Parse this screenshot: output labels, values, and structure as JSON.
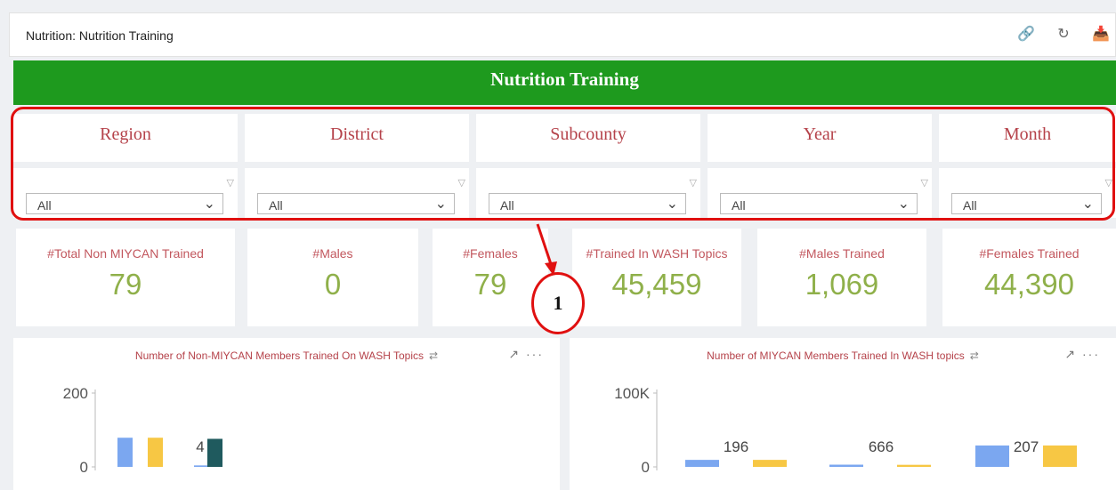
{
  "header": {
    "title": "Nutrition: Nutrition Training",
    "icons": [
      "link-icon",
      "refresh-icon",
      "inbox-download-icon"
    ]
  },
  "banner": {
    "title": "Nutrition Training"
  },
  "filters": [
    {
      "label": "Region",
      "value": "All"
    },
    {
      "label": "District",
      "value": "All"
    },
    {
      "label": "Subcounty",
      "value": "All"
    },
    {
      "label": "Year",
      "value": "All"
    },
    {
      "label": "Month",
      "value": "All"
    }
  ],
  "kpis": [
    {
      "label": "#Total Non MIYCAN Trained",
      "value": "79"
    },
    {
      "label": "#Males",
      "value": "0"
    },
    {
      "label": "#Females",
      "value": "79"
    },
    {
      "label": "#Trained In WASH Topics",
      "value": "45,459"
    },
    {
      "label": "#Males Trained",
      "value": "1,069"
    },
    {
      "label": "#Females Trained",
      "value": "44,390"
    }
  ],
  "annotation": {
    "callout_number": "1",
    "outline_color": "#e01010"
  },
  "colors": {
    "banner": "#1e9a1e",
    "label_red": "#b5424a",
    "kpi_green": "#8fb04a",
    "bar_blue": "#7ba7f0",
    "bar_yellow": "#f7c744",
    "bar_teal": "#1f5a5e"
  },
  "chart_data": [
    {
      "type": "bar",
      "title": "Number of Non-MIYCAN Members Trained On WASH Topics",
      "ylim": [
        0,
        200
      ],
      "yticks": [
        "0",
        "200"
      ],
      "series": [
        {
          "values": [
            79,
            0,
            0
          ]
        },
        {
          "values": [
            79,
            0,
            0
          ]
        },
        {
          "values": [
            0,
            4,
            0
          ]
        },
        {
          "values": [
            0,
            76,
            0
          ]
        }
      ],
      "data_labels": [
        {
          "text": "4"
        }
      ]
    },
    {
      "type": "bar",
      "title": "Number of MIYCAN Members Trained In WASH topics",
      "ylim": [
        0,
        100000
      ],
      "yticks": [
        "0",
        "100K"
      ],
      "series": [
        {
          "values": [
            9500,
            3000,
            29000
          ]
        },
        {
          "values": [
            9500,
            2800,
            29000
          ]
        }
      ],
      "data_labels": [
        {
          "text": "196"
        },
        {
          "text": "666"
        },
        {
          "text": "207"
        }
      ]
    }
  ]
}
